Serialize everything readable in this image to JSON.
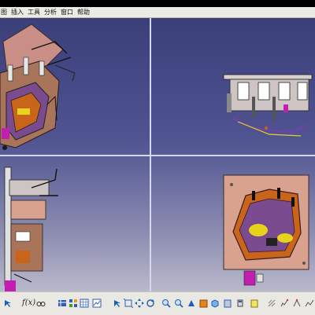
{
  "menu": {
    "items": [
      "图",
      "插入",
      "工具",
      "分析",
      "窗口",
      "帮助"
    ]
  },
  "toolbar": {
    "formula_label": "f(x)",
    "icons": [
      "help-arrow-icon",
      "formula-icon",
      "binoculars-icon",
      "ruler-icon",
      "table-icon",
      "multi-view-icon",
      "grid-icon",
      "graph-icon",
      "select-arrow-icon",
      "fit-all-icon",
      "pan-icon",
      "rotate-icon",
      "zoom-in-icon",
      "zoom-out-icon",
      "normal-view-icon",
      "iso-view-icon",
      "shading-icon",
      "hide-show-icon",
      "swap-visible-icon",
      "measure-icon",
      "properties-icon",
      "sketch-icon",
      "snap-icon"
    ]
  },
  "colors": {
    "viewport_top": "#3a3f7a",
    "viewport_bottom": "#b9b9cc",
    "fixture_plate": "#d8a28e",
    "part_orange": "#c8651a",
    "part_yellow": "#e8d21c",
    "accent_magenta": "#c21fb0"
  }
}
